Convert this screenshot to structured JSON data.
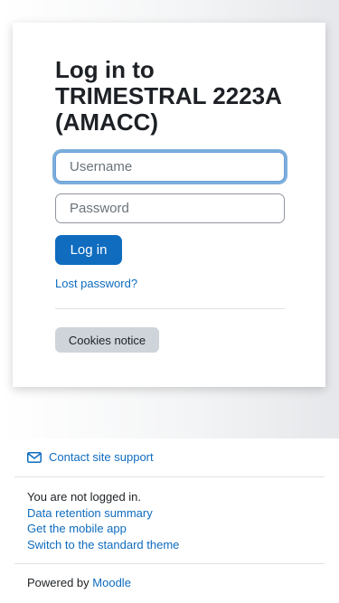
{
  "login": {
    "title": "Log in to TRIMESTRAL 2223A (AMACC)",
    "username_placeholder": "Username",
    "password_placeholder": "Password",
    "login_button": "Log in",
    "lost_password": "Lost password?",
    "cookies_button": "Cookies notice"
  },
  "footer": {
    "contact_support": "Contact site support",
    "not_logged_in": "You are not logged in.",
    "data_retention": "Data retention summary",
    "mobile_app": "Get the mobile app",
    "standard_theme": "Switch to the standard theme",
    "powered_by": "Powered by",
    "moodle": "Moodle"
  },
  "colors": {
    "primary": "#0f6cbf",
    "secondary_button": "#ced4da",
    "text": "#1d2125"
  },
  "icons": {
    "contact": "envelope-icon"
  }
}
